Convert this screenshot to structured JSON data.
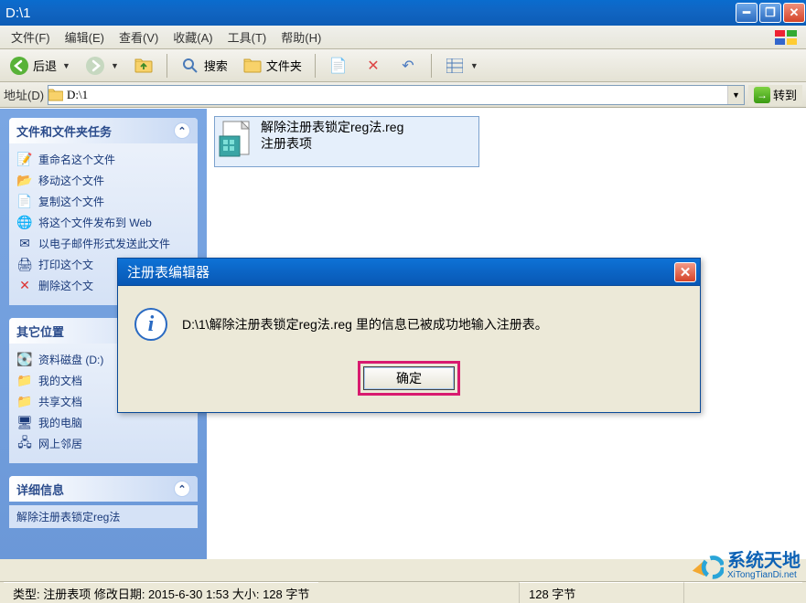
{
  "window": {
    "title": "D:\\1"
  },
  "menu": {
    "file": "文件(F)",
    "edit": "编辑(E)",
    "view": "查看(V)",
    "favorites": "收藏(A)",
    "tools": "工具(T)",
    "help": "帮助(H)"
  },
  "toolbar": {
    "back": "后退",
    "search": "搜索",
    "folders": "文件夹"
  },
  "address": {
    "label": "地址(D)",
    "path": "D:\\1",
    "go": "转到"
  },
  "sidebar": {
    "tasks": {
      "title": "文件和文件夹任务",
      "items": [
        "重命名这个文件",
        "移动这个文件",
        "复制这个文件",
        "将这个文件发布到 Web",
        "以电子邮件形式发送此文件",
        "打印这个文",
        "删除这个文"
      ]
    },
    "other": {
      "title": "其它位置",
      "items": [
        "资料磁盘 (D:)",
        "我的文档",
        "共享文档",
        "我的电脑",
        "网上邻居"
      ]
    },
    "detail": {
      "title": "详细信息",
      "file": "解除注册表锁定reg法"
    }
  },
  "file": {
    "name": "解除注册表锁定reg法.reg",
    "type": "注册表项"
  },
  "dialog": {
    "title": "注册表编辑器",
    "message": "D:\\1\\解除注册表锁定reg法.reg 里的信息已被成功地输入注册表。",
    "ok": "确定"
  },
  "status": {
    "left": "类型: 注册表项 修改日期: 2015-6-30 1:53 大小: 128 字节",
    "size": "128 字节"
  },
  "watermark": {
    "brand": "系统天地",
    "url": "XiTongTianDi.net"
  }
}
